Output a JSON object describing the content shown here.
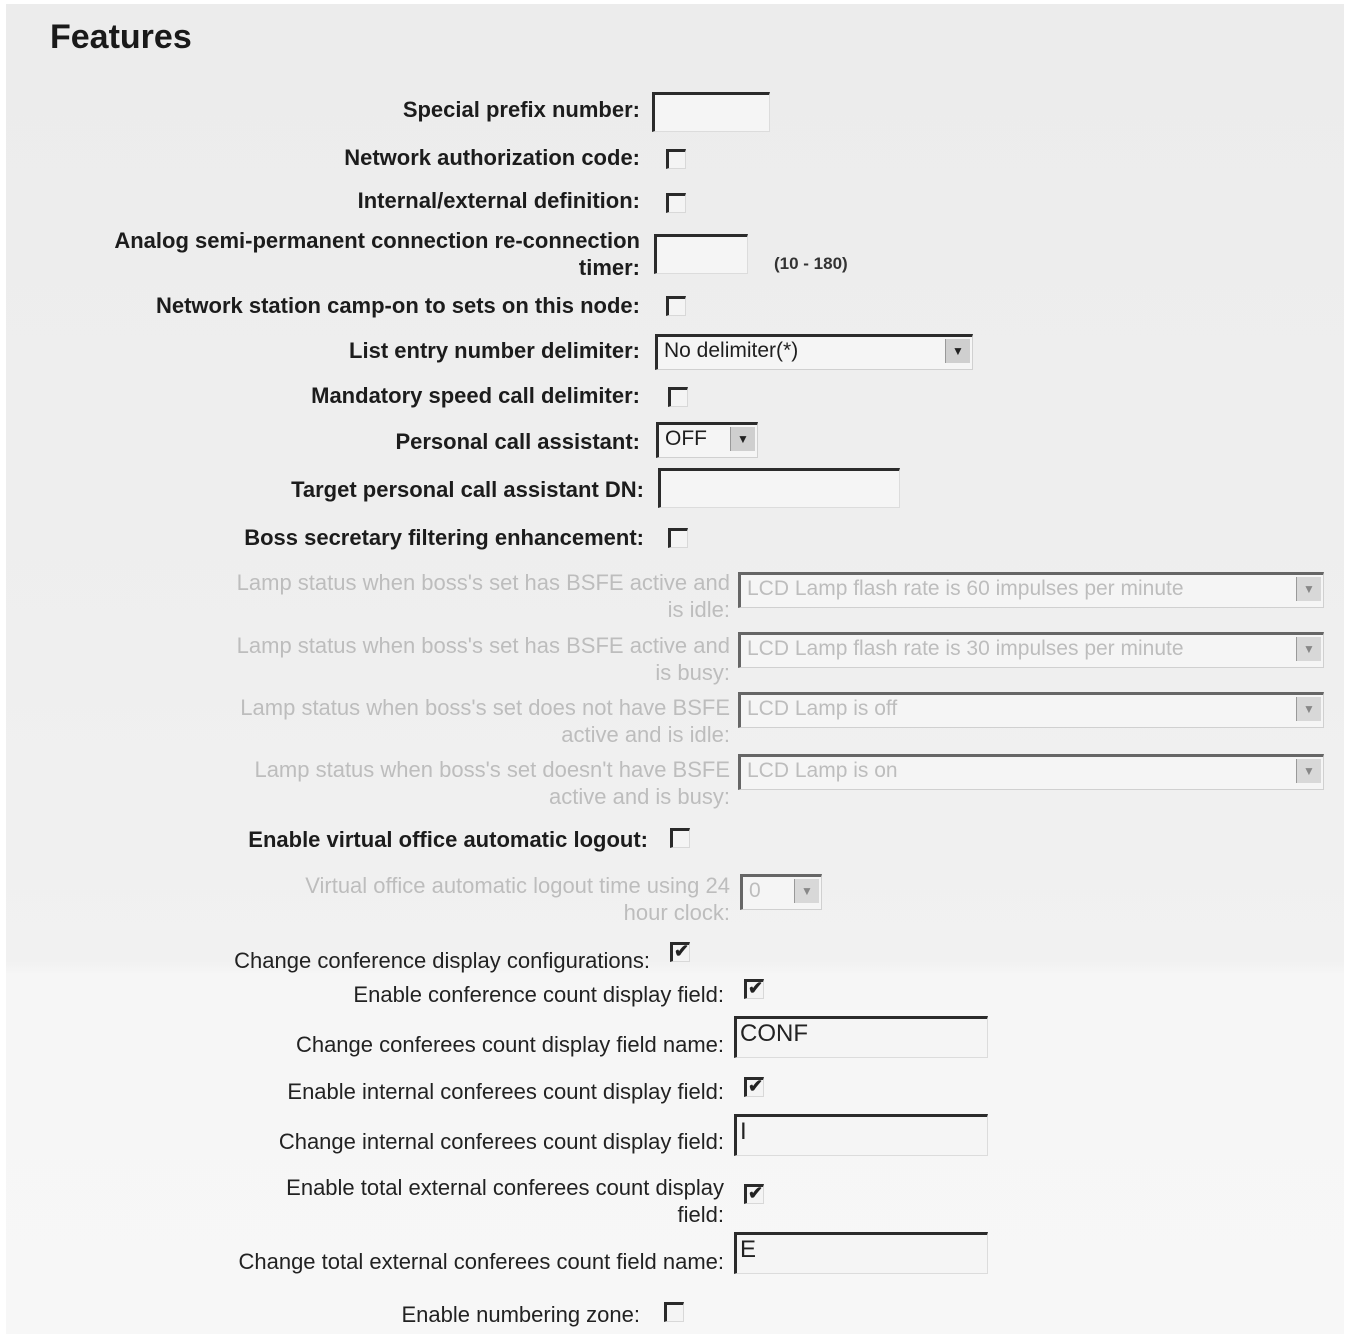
{
  "title": "Features",
  "fields": {
    "special_prefix": {
      "label": "Special prefix number:",
      "value": ""
    },
    "network_auth": {
      "label": "Network authorization code:",
      "checked": false
    },
    "internal_external": {
      "label": "Internal/external definition:",
      "checked": false
    },
    "analog_timer": {
      "label_line1": "Analog semi-permanent connection re-connection",
      "label_line2": "timer:",
      "value": "",
      "range": "(10 - 180)"
    },
    "camp_on": {
      "label": "Network station camp-on to sets on this node:",
      "checked": false
    },
    "list_delimiter": {
      "label": "List entry number delimiter:",
      "value": "No delimiter(*)"
    },
    "mandatory_speed": {
      "label": "Mandatory speed call delimiter:",
      "checked": false
    },
    "personal_assistant": {
      "label": "Personal call assistant:",
      "value": "OFF"
    },
    "target_pca_dn": {
      "label": "Target personal call assistant DN:",
      "value": ""
    },
    "boss_secretary": {
      "label": "Boss secretary filtering enhancement:",
      "checked": false
    },
    "lamp_bsfe_idle": {
      "label_line1": "Lamp status when boss's set has BSFE active and",
      "label_line2": "is idle:",
      "value": "LCD Lamp flash rate is 60 impulses per minute"
    },
    "lamp_bsfe_busy": {
      "label_line1": "Lamp status when boss's set has BSFE active and",
      "label_line2": "is busy:",
      "value": "LCD Lamp flash rate is 30 impulses per minute"
    },
    "lamp_nobsfe_idle": {
      "label_line1": "Lamp status when boss's set does not have BSFE",
      "label_line2": "active and is idle:",
      "value": "LCD Lamp is off"
    },
    "lamp_nobsfe_busy": {
      "label_line1": "Lamp status when boss's set doesn't have BSFE",
      "label_line2": "active and is busy:",
      "value": "LCD Lamp is on"
    },
    "virtual_logout": {
      "label": "Enable virtual office automatic logout:",
      "checked": false
    },
    "virtual_logout_time": {
      "label_line1": "Virtual office automatic logout time using 24",
      "label_line2": "hour clock:",
      "value": "0"
    },
    "conf_display_config": {
      "label": "Change conference display configurations:",
      "checked": true
    },
    "conf_count_display": {
      "label": "Enable conference count display field:",
      "checked": true
    },
    "conferees_name": {
      "label": "Change conferees count display field name:",
      "value": "CONF"
    },
    "internal_conferees_enable": {
      "label": "Enable internal conferees count display field:",
      "checked": true
    },
    "internal_conferees_field": {
      "label": "Change internal conferees count display field:",
      "value": "I"
    },
    "external_conferees_enable": {
      "label_line1": "Enable total external conferees count display",
      "label_line2": "field:",
      "checked": true
    },
    "external_conferees_name": {
      "label": "Change total external conferees count field name:",
      "value": "E"
    },
    "numbering_zone": {
      "label": "Enable numbering zone:",
      "checked": false
    }
  },
  "check_mark": "✔",
  "arrow": "▼"
}
